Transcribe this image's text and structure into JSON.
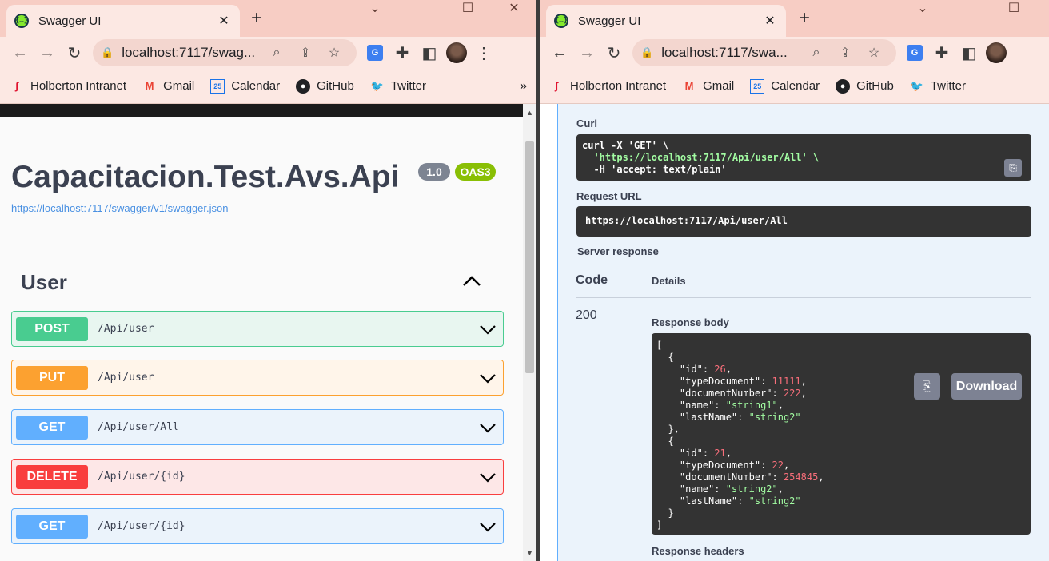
{
  "browser": {
    "tab_title": "Swagger UI",
    "url": "localhost:7117/swa...",
    "url_left": "localhost:7117/swag...",
    "bookmarks": [
      "Holberton Intranet",
      "Gmail",
      "Calendar",
      "GitHub",
      "Twitter"
    ]
  },
  "left": {
    "api_title": "Capacitacion.Test.Avs.Api",
    "version": "1.0",
    "oas": "OAS3",
    "spec_url": "https://localhost:7117/swagger/v1/swagger.json",
    "section": "User",
    "operations": [
      {
        "method": "POST",
        "path": "/Api/user"
      },
      {
        "method": "PUT",
        "path": "/Api/user"
      },
      {
        "method": "GET",
        "path": "/Api/user/All"
      },
      {
        "method": "DELETE",
        "path": "/Api/user/{id}"
      },
      {
        "method": "GET",
        "path": "/Api/user/{id}"
      }
    ]
  },
  "right": {
    "curl_label": "Curl",
    "curl_lines": [
      "curl -X 'GET' \\",
      "  'https://localhost:7117/Api/user/All' \\",
      "  -H 'accept: text/plain'"
    ],
    "request_url_label": "Request URL",
    "request_url": "https://localhost:7117/Api/user/All",
    "server_response_label": "Server response",
    "code_header": "Code",
    "details_header": "Details",
    "status_code": "200",
    "response_body_label": "Response body",
    "response_headers_label": "Response headers",
    "download_label": "Download",
    "users": [
      {
        "id": 26,
        "typeDocument": 11111,
        "documentNumber": 222,
        "name": "string1",
        "lastName": "string2"
      },
      {
        "id": 21,
        "typeDocument": 22,
        "documentNumber": 254845,
        "name": "string2",
        "lastName": "string2"
      }
    ]
  },
  "colors": {
    "POST": {
      "bg": "#e8f6f0",
      "border": "#49cc90",
      "badge": "#49cc90"
    },
    "PUT": {
      "bg": "#fff5ea",
      "border": "#fca130",
      "badge": "#fca130"
    },
    "GET": {
      "bg": "#ebf3fb",
      "border": "#61affe",
      "badge": "#61affe"
    },
    "DELETE": {
      "bg": "#fde7e7",
      "border": "#f93e3e",
      "badge": "#f93e3e"
    }
  }
}
